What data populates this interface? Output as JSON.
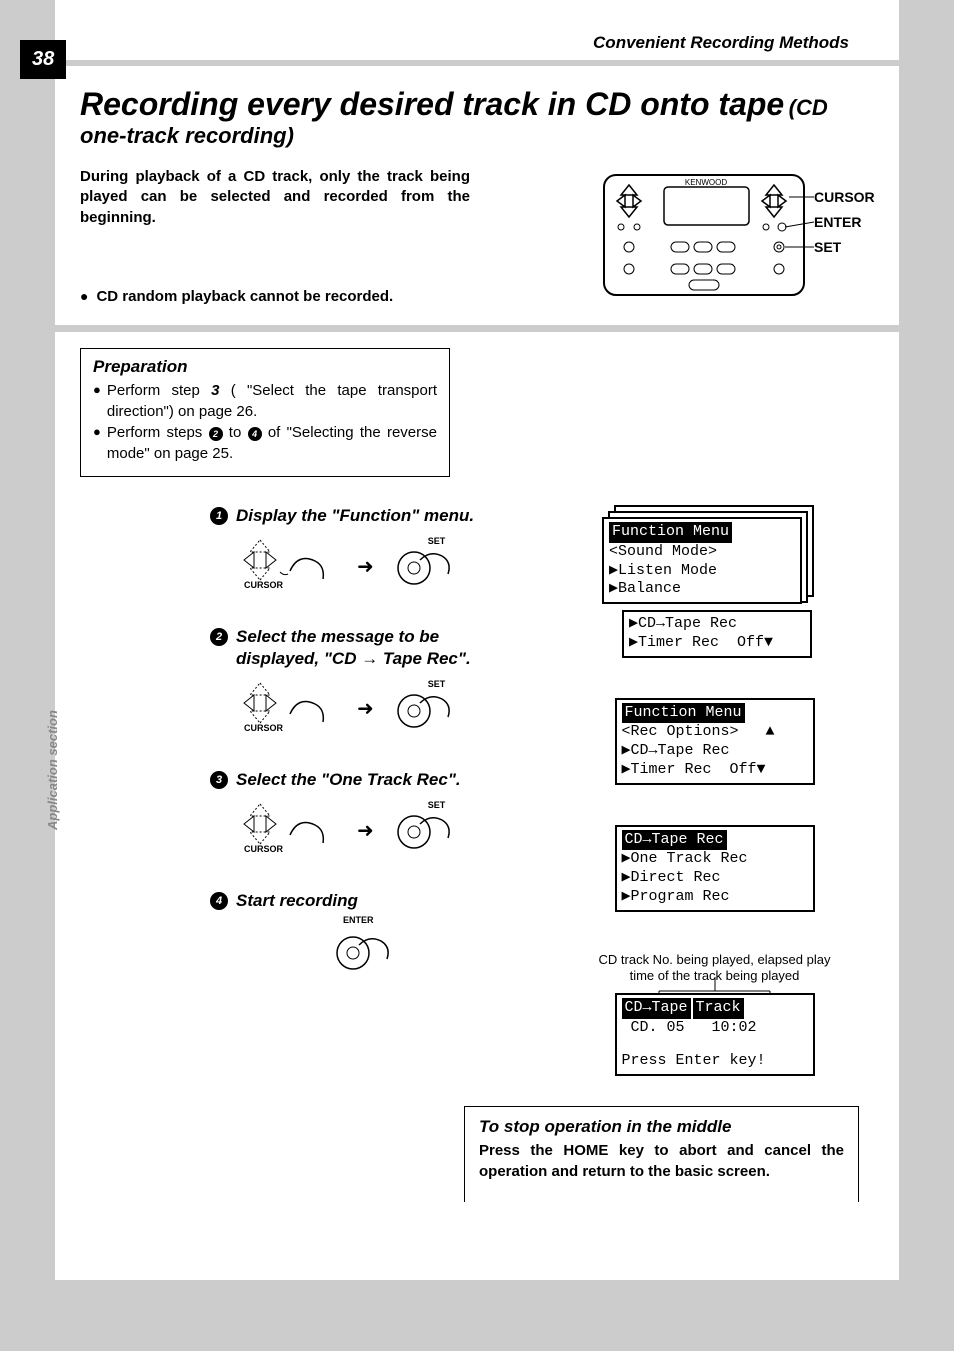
{
  "page_number": "38",
  "chapter": "Convenient Recording Methods",
  "main_title": "Recording every desired track in CD onto tape",
  "sub_title": "(CD one-track recording)",
  "intro": "During playback of a CD track, only the track being played can be selected and recorded from the beginning.",
  "note1": "CD random playback cannot be recorded.",
  "remote": {
    "brand": "KENWOOD",
    "labels": {
      "cursor": "CURSOR",
      "enter": "ENTER",
      "set": "SET"
    }
  },
  "prep": {
    "title": "Preparation",
    "item1_a": "Perform step ",
    "item1_b": "3",
    "item1_c": " ( \"Select the tape transport direction\") on page 26.",
    "item2_a": "Perform steps ",
    "item2_b": "2",
    "item2_c": " to ",
    "item2_d": "4",
    "item2_e": " of  \"Selecting the reverse mode\" on page 25."
  },
  "steps": {
    "s1": {
      "num": "1",
      "title": "Display the \"Function\" menu."
    },
    "s2": {
      "num": "2",
      "title": "Select the message to be displayed, \"CD → Tape Rec\"."
    },
    "s3": {
      "num": "3",
      "title": "Select the \"One Track Rec\"."
    },
    "s4": {
      "num": "4",
      "title": "Start recording"
    }
  },
  "action_labels": {
    "cursor": "CURSOR",
    "set": "SET",
    "enter": "ENTER"
  },
  "screens": {
    "s1": {
      "title": "Function Menu",
      "l1": "<Sound Mode>",
      "l2": "▶Listen Mode",
      "l3": "▶Balance",
      "l4": "▶CD→Tape Rec",
      "l5": "▶Timer Rec  Off▼"
    },
    "s2": {
      "title": "Function Menu",
      "l1": "<Rec Options>   ▲",
      "l2": "▶CD→Tape Rec",
      "l3": "▶Timer Rec  Off▼"
    },
    "s3": {
      "title": "CD→Tape Rec",
      "l1": "▶One Track Rec",
      "l2": "▶Direct Rec",
      "l3": "▶Program Rec"
    },
    "s4": {
      "caption": "CD track No. being played, elapsed play time of the track being played",
      "title_l": "CD→Tape",
      "title_r": "Track",
      "l1": " CD. 05   10:02",
      "l2": "Press Enter key!"
    }
  },
  "stop_box": {
    "title": "To stop operation in the middle",
    "body": "Press the HOME key to abort and cancel the operation and return to the basic screen."
  },
  "side_label": "Application section"
}
